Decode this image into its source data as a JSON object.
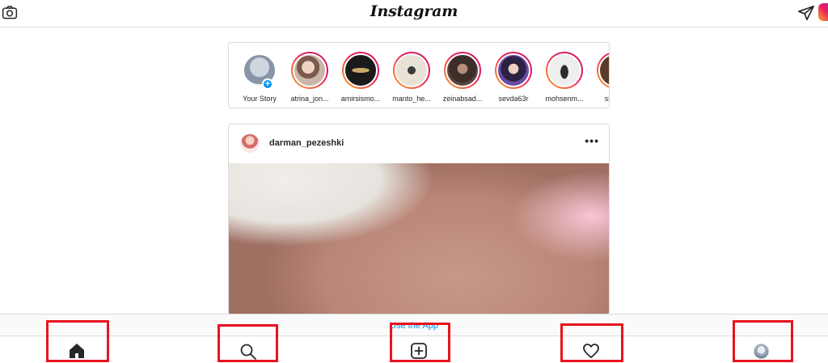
{
  "header": {
    "logo": "Instagram"
  },
  "stories": [
    {
      "name": "Your Story",
      "own": true
    },
    {
      "name": "atrina_jon..."
    },
    {
      "name": "amirsismo..."
    },
    {
      "name": "manto_he..."
    },
    {
      "name": "zeinabsad..."
    },
    {
      "name": "sevda63r"
    },
    {
      "name": "mohsenm..."
    },
    {
      "name": "sima..."
    }
  ],
  "post": {
    "username": "darman_pezeshki",
    "more_label": "•••"
  },
  "bottom": {
    "use_app": "Use the App"
  },
  "nav": {
    "items": [
      "home",
      "search",
      "new-post",
      "activity",
      "profile"
    ]
  },
  "colors": {
    "accent": "#0095f6",
    "highlight_box": "#e8141e",
    "story_ring": "#e91e63"
  }
}
